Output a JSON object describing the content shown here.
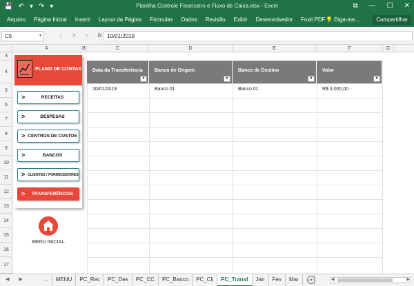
{
  "window": {
    "title": "Planilha Controle Financeiro e Fluxo de Caixa.xlsx - Excel",
    "controls": {
      "restore": "⧉",
      "minimize": "—",
      "maximize": "☐",
      "close": "✕"
    }
  },
  "qat": {
    "save": "💾",
    "undo": "↶",
    "undo_arrow": "▾",
    "redo": "↷",
    "customize": "▾"
  },
  "ribbon": {
    "tabs": [
      "Arquivo",
      "Página Inicial",
      "Inserir",
      "Layout da Página",
      "Fórmulas",
      "Dados",
      "Revisão",
      "Exibir",
      "Desenvolvedor",
      "Foxit PDF"
    ],
    "tell_me": "💡 Diga-me...",
    "share": "Compartilhar"
  },
  "formula_bar": {
    "name_box": "C5",
    "name_box_arrow": "▾",
    "more": "⋮",
    "cancel": "✕",
    "enter": "✓",
    "fx": "fx",
    "value": "10/01/2019"
  },
  "columns": [
    "A",
    "B",
    "C",
    "D",
    "E",
    "F",
    "G"
  ],
  "rows": [
    "3",
    "4",
    "5",
    "6",
    "7",
    "8",
    "9",
    "10",
    "11",
    "12",
    "13",
    "14",
    "15",
    "16",
    "17"
  ],
  "panel": {
    "title": "PLANO DE CONTAS",
    "chevron": ">",
    "buttons": [
      {
        "label": "RECEITAS"
      },
      {
        "label": "DESPESAS"
      },
      {
        "label": "CENTROS DE CUSTOS"
      },
      {
        "label": "BANCOS"
      },
      {
        "label": "CLIENTES / FORNECEDORES"
      },
      {
        "label": "TRANSFERÊNCIAS"
      }
    ],
    "home_label": "MENU INICIAL"
  },
  "table": {
    "drop_icon": "▾",
    "headers": [
      "Data da Transferência",
      "Banco de Origem",
      "Banco de Destino",
      "Valor"
    ],
    "rows": [
      [
        "10/01/2019",
        "Banco 01",
        "Banco 01",
        "R$ 3.000,00"
      ]
    ]
  },
  "sheetbar": {
    "prev": "◀",
    "next": "▶",
    "tabs": [
      "...",
      "MENU",
      "PC_Rec",
      "PC_Des",
      "PC_CC",
      "PC_Banco",
      "PC_Cli",
      "PC_Transf",
      "Jan",
      "Fev",
      "Mar",
      "..."
    ],
    "active_tab": "PC_Transf",
    "add": "+",
    "scroll_left": "◀",
    "scroll_right": "▶"
  },
  "colors": {
    "excel_green": "#217346",
    "accent_red": "#e9473a",
    "header_gray": "#7a7a7a",
    "button_border": "#2f7d8f"
  }
}
